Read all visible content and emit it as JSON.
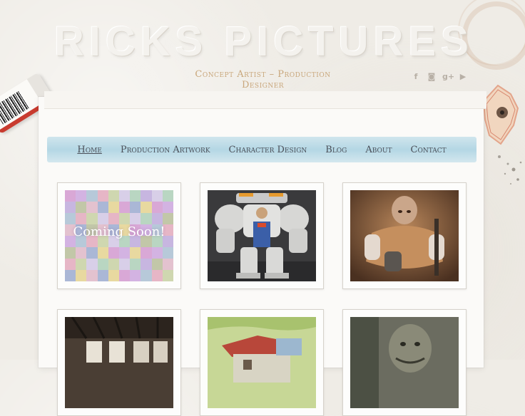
{
  "header": {
    "brand": "RICKS PICTURES",
    "tagline": "Concept Artist – Production Designer",
    "social": [
      {
        "icon": "facebook-icon",
        "glyph": "f"
      },
      {
        "icon": "instagram-icon",
        "glyph": "◙"
      },
      {
        "icon": "google-plus-icon",
        "glyph": "g+"
      },
      {
        "icon": "youtube-icon",
        "glyph": "▶"
      }
    ]
  },
  "nav": {
    "items": [
      "Home",
      "Production Artwork",
      "Character Design",
      "Blog",
      "About",
      "Contact"
    ],
    "active": "Home"
  },
  "gallery": {
    "items": [
      {
        "alt": "coming-soon-placeholder",
        "overlay": "Coming Soon!"
      },
      {
        "alt": "armored-robot-artwork",
        "overlay": ""
      },
      {
        "alt": "creature-character-artwork",
        "overlay": ""
      },
      {
        "alt": "interior-room-artwork",
        "overlay": ""
      },
      {
        "alt": "cabin-landscape-artwork",
        "overlay": ""
      },
      {
        "alt": "orc-creature-artwork",
        "overlay": ""
      }
    ]
  },
  "colors": {
    "nav_band": "#9fcfe0",
    "tagline": "#c9a77c",
    "nav_text": "#4a4f58",
    "eraser_stripe": "#c83b2f"
  }
}
